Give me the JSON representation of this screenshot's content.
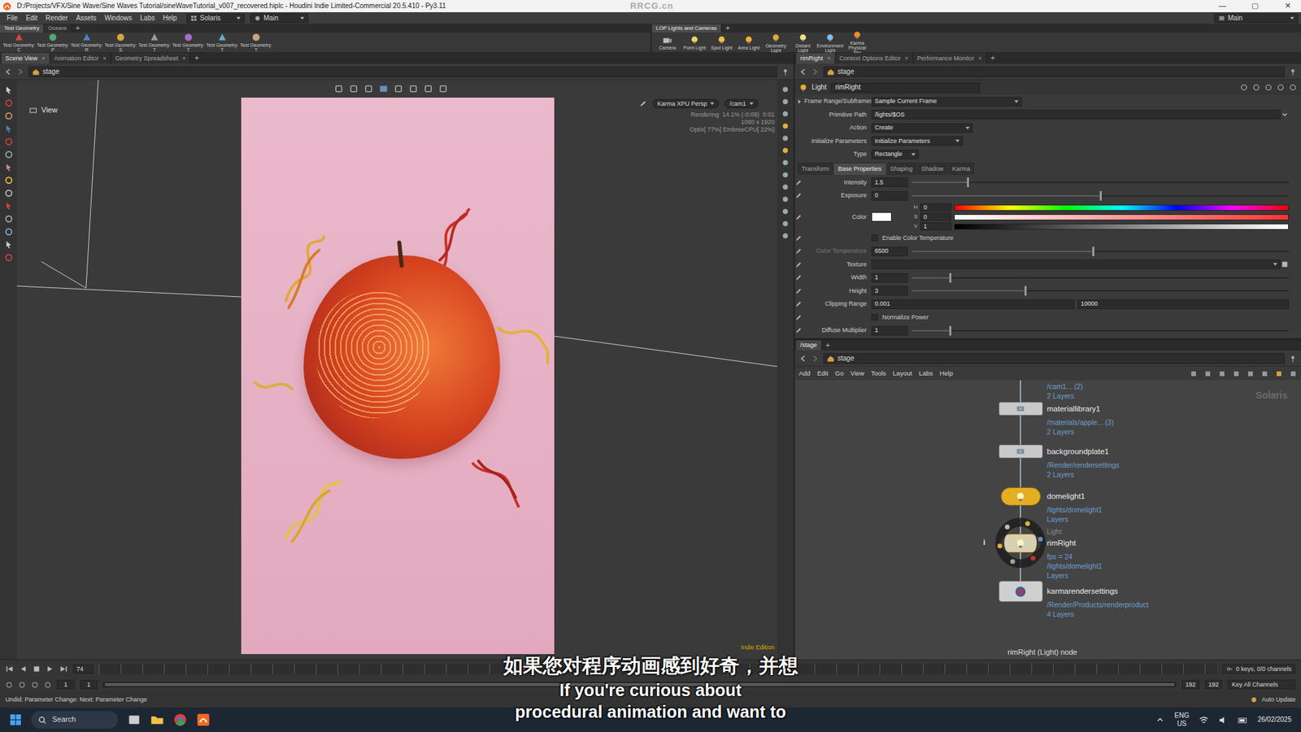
{
  "window": {
    "title": "D:/Projects/VFX/Sine Wave/Sine Waves Tutorial/sineWaveTutorial_v007_recovered.hiplc - Houdini Indie Limited-Commercial 20.5.410 - Py3.11",
    "controls": [
      "—",
      "▢",
      "✕"
    ]
  },
  "watermark": "RRCG.cn",
  "menu": {
    "items": [
      "File",
      "Edit",
      "Render",
      "Assets",
      "Windows",
      "Labs",
      "Help"
    ],
    "desktop": "Solaris",
    "context": "Main",
    "right": "Main"
  },
  "shelf": {
    "left": {
      "tabs": [
        {
          "label": "Test Geometry",
          "selected": true
        },
        {
          "label": "Oceans",
          "selected": false
        }
      ],
      "add": "+",
      "tools": [
        "Test Geometry: C",
        "Test Geometry: P",
        "Test Geometry: R",
        "Test Geometry: S",
        "Test Geometry: T",
        "Test Geometry: T",
        "Test Geometry: T",
        "Test Geometry: T"
      ]
    },
    "right": {
      "tabs": [
        {
          "label": "LOP Lights and Cameras",
          "selected": true
        }
      ],
      "add": "+",
      "tools": [
        "Camera",
        "Point Light",
        "Spot Light",
        "Area Light",
        "Geometry Light",
        "Distant Light",
        "Environment Light",
        "Karma Physical Sky"
      ]
    }
  },
  "left_pane": {
    "tabs": [
      {
        "label": "Scene View",
        "selected": true
      },
      {
        "label": "Animation Editor",
        "selected": false
      },
      {
        "label": "Geometry Spreadsheet",
        "selected": false
      }
    ],
    "close": "×",
    "add": "+",
    "path": "stage"
  },
  "viewport": {
    "label": "View",
    "renderer": "Karma XPU Persp",
    "camera": "/cam1",
    "stats": [
      "Rendering  14.1% (-0:08)  0:01",
      "1080 x 1920",
      "Optix[ 77%] EmbreeCPU[ 22%]"
    ],
    "edition": "Indie Edition"
  },
  "params": {
    "tabs": [
      {
        "label": "rimRight",
        "selected": true
      },
      {
        "label": "Context Options Editor",
        "selected": false
      },
      {
        "label": "Performance Monitor",
        "selected": false
      }
    ],
    "close": "×",
    "add": "+",
    "path": "stage",
    "node_type": "Light",
    "node_name": "rimRight",
    "top_rows": [
      {
        "kind": "menu",
        "label": "Frame Range/Subframes",
        "value": "Sample Current Frame"
      },
      {
        "kind": "text",
        "label": "Primitive Path",
        "value": "/lights/$OS"
      },
      {
        "kind": "menu",
        "label": "Action",
        "value": "Create"
      },
      {
        "kind": "menu",
        "label": "Initialize Parameters",
        "value": "Initialize Parameters"
      },
      {
        "kind": "menu",
        "label": "Type",
        "value": "Rectangle"
      }
    ],
    "subtabs": [
      {
        "label": "Transform",
        "selected": false
      },
      {
        "label": "Base Properties",
        "selected": true
      },
      {
        "label": "Shaping",
        "selected": false
      },
      {
        "label": "Shadow",
        "selected": false
      },
      {
        "label": "Karma",
        "selected": false
      }
    ],
    "rows": [
      {
        "kind": "slider",
        "label": "Intensity",
        "value": "1.5",
        "level": 0.147,
        "disabled": false
      },
      {
        "kind": "slider",
        "label": "Exposure",
        "value": "0",
        "level": 0.5,
        "disabled": false
      },
      {
        "kind": "color",
        "label": "Color",
        "swatch": "#ffffff",
        "channels": [
          {
            "name": "H",
            "value": "0"
          },
          {
            "name": "S",
            "value": "0"
          },
          {
            "name": "V",
            "value": "1"
          }
        ]
      },
      {
        "kind": "check",
        "label": "Enable Color Temperature",
        "checked": false
      },
      {
        "kind": "slider",
        "label": "Color Temperature",
        "value": "6500",
        "level": 0.48,
        "disabled": true
      },
      {
        "kind": "file",
        "label": "Texture"
      },
      {
        "kind": "slider",
        "label": "Width",
        "value": "1",
        "level": 0.1,
        "disabled": false
      },
      {
        "kind": "slider",
        "label": "Height",
        "value": "3",
        "level": 0.3,
        "disabled": false
      },
      {
        "kind": "pair",
        "label": "Clipping Range",
        "values": [
          "0.001",
          "10000"
        ]
      },
      {
        "kind": "check",
        "label": "Normalize Power",
        "checked": false
      },
      {
        "kind": "slider",
        "label": "Diffuse Multiplier",
        "value": "1",
        "level": 0.1,
        "disabled": false
      }
    ]
  },
  "network": {
    "tabs": [
      {
        "label": "/stage",
        "selected": true
      }
    ],
    "add": "+",
    "path": "stage",
    "menu": [
      "Add",
      "Edit",
      "Go",
      "View",
      "Tools",
      "Layout",
      "Labs",
      "Help"
    ],
    "context": "Solaris",
    "top_info": [
      "/cam1... (2)",
      "2 Layers"
    ],
    "nodes": [
      {
        "name": "materiallibrary1",
        "kind": "lop",
        "selected": false,
        "info": [
          "/materials/apple... (3)",
          "2 Layers"
        ]
      },
      {
        "name": "backgroundplate1",
        "kind": "lop",
        "selected": false,
        "info": [
          "/Render/rendersettings",
          "2 Layers"
        ]
      },
      {
        "name": "domelight1",
        "kind": "light",
        "selected": false,
        "info": [
          "/lights/domelight1",
          "Layers"
        ]
      },
      {
        "name": "rimRight",
        "kind": "light",
        "selected": true,
        "above": "Light",
        "info": [
          "fps = 24",
          "/lights/domelight1",
          "Layers"
        ]
      },
      {
        "name": "karmarendersettings",
        "kind": "render",
        "selected": false,
        "info": [
          "/Render/Products/renderproduct",
          "4 Layers"
        ]
      }
    ],
    "ring_info": "i",
    "footer": "rimRight (Light) node"
  },
  "timeline": {
    "frame": "74",
    "level": 0.38,
    "keys": "0 keys, 0/0 channels",
    "start": "1",
    "start_field": "1",
    "end": "192",
    "end_field": "192",
    "key_all": "Key All Channels",
    "auto_update": "Auto Update"
  },
  "status": "Undid: Parameter Change: Next: Parameter Change",
  "taskbar": {
    "search": "Search",
    "lang": "ENG",
    "region": "US",
    "date": "26/02/2025"
  },
  "subtitles": [
    "如果您对程序动画感到好奇，并想",
    "If you're curious about",
    "procedural animation and want to"
  ]
}
